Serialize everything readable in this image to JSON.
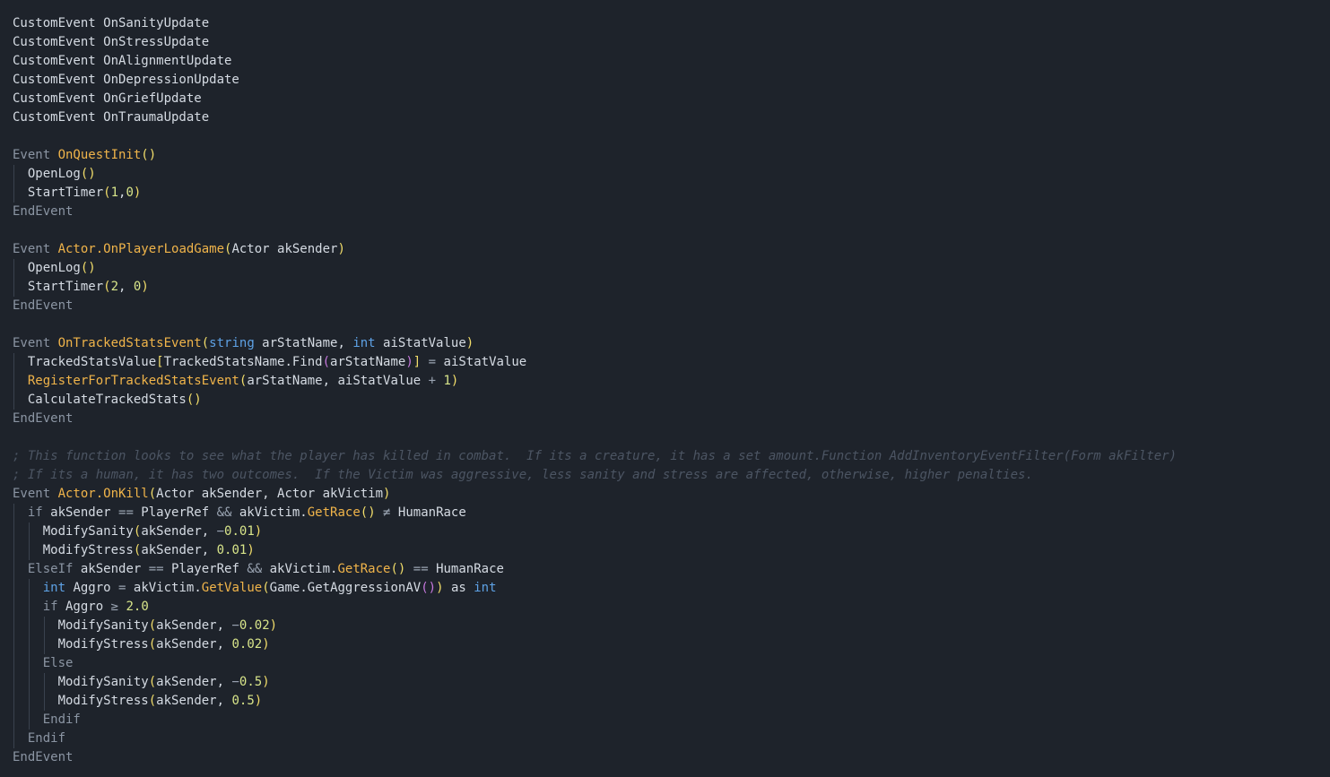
{
  "theme": {
    "background": "#1e232b",
    "text": "#d5dbe3",
    "keyword": "#8b95a3",
    "type": "#5ea2e6",
    "function": "#f0b44a",
    "bracket": "#f2dd6a",
    "bracket_nested": "#c678dd",
    "number": "#d8e58a",
    "operator": "#9aa4b2",
    "comment": "#4c5563"
  },
  "code": {
    "lines": [
      {
        "indent": 0,
        "tokens": [
          {
            "t": "CustomEvent OnSanityUpdate",
            "c": "default"
          }
        ]
      },
      {
        "indent": 0,
        "tokens": [
          {
            "t": "CustomEvent OnStressUpdate",
            "c": "default"
          }
        ]
      },
      {
        "indent": 0,
        "tokens": [
          {
            "t": "CustomEvent OnAlignmentUpdate",
            "c": "default"
          }
        ]
      },
      {
        "indent": 0,
        "tokens": [
          {
            "t": "CustomEvent OnDepressionUpdate",
            "c": "default"
          }
        ]
      },
      {
        "indent": 0,
        "tokens": [
          {
            "t": "CustomEvent OnGriefUpdate",
            "c": "default"
          }
        ]
      },
      {
        "indent": 0,
        "tokens": [
          {
            "t": "CustomEvent OnTraumaUpdate",
            "c": "default"
          }
        ]
      },
      {
        "indent": 0,
        "tokens": []
      },
      {
        "indent": 0,
        "tokens": [
          {
            "t": "Event ",
            "c": "kw"
          },
          {
            "t": "OnQuestInit",
            "c": "fn"
          },
          {
            "t": "()",
            "c": "punc"
          }
        ]
      },
      {
        "indent": 1,
        "tokens": [
          {
            "t": "OpenLog",
            "c": "default"
          },
          {
            "t": "()",
            "c": "punc"
          }
        ]
      },
      {
        "indent": 1,
        "tokens": [
          {
            "t": "StartTimer",
            "c": "default"
          },
          {
            "t": "(",
            "c": "punc"
          },
          {
            "t": "1",
            "c": "num"
          },
          {
            "t": ",",
            "c": "default"
          },
          {
            "t": "0",
            "c": "num"
          },
          {
            "t": ")",
            "c": "punc"
          }
        ]
      },
      {
        "indent": 0,
        "tokens": [
          {
            "t": "EndEvent",
            "c": "kw"
          }
        ]
      },
      {
        "indent": 0,
        "tokens": []
      },
      {
        "indent": 0,
        "tokens": [
          {
            "t": "Event ",
            "c": "kw"
          },
          {
            "t": "Actor.OnPlayerLoadGame",
            "c": "fn"
          },
          {
            "t": "(",
            "c": "punc"
          },
          {
            "t": "Actor akSender",
            "c": "default"
          },
          {
            "t": ")",
            "c": "punc"
          }
        ]
      },
      {
        "indent": 1,
        "tokens": [
          {
            "t": "OpenLog",
            "c": "default"
          },
          {
            "t": "()",
            "c": "punc"
          }
        ]
      },
      {
        "indent": 1,
        "tokens": [
          {
            "t": "StartTimer",
            "c": "default"
          },
          {
            "t": "(",
            "c": "punc"
          },
          {
            "t": "2",
            "c": "num"
          },
          {
            "t": ", ",
            "c": "default"
          },
          {
            "t": "0",
            "c": "num"
          },
          {
            "t": ")",
            "c": "punc"
          }
        ]
      },
      {
        "indent": 0,
        "tokens": [
          {
            "t": "EndEvent",
            "c": "kw"
          }
        ]
      },
      {
        "indent": 0,
        "tokens": []
      },
      {
        "indent": 0,
        "tokens": [
          {
            "t": "Event ",
            "c": "kw"
          },
          {
            "t": "OnTrackedStatsEvent",
            "c": "fn"
          },
          {
            "t": "(",
            "c": "punc"
          },
          {
            "t": "string",
            "c": "type"
          },
          {
            "t": " arStatName, ",
            "c": "default"
          },
          {
            "t": "int",
            "c": "type"
          },
          {
            "t": " aiStatValue",
            "c": "default"
          },
          {
            "t": ")",
            "c": "punc"
          }
        ]
      },
      {
        "indent": 1,
        "tokens": [
          {
            "t": "TrackedStatsValue",
            "c": "default"
          },
          {
            "t": "[",
            "c": "punc"
          },
          {
            "t": "TrackedStatsName.Find",
            "c": "default"
          },
          {
            "t": "(",
            "c": "bracket2"
          },
          {
            "t": "arStatName",
            "c": "default"
          },
          {
            "t": ")",
            "c": "bracket2"
          },
          {
            "t": "]",
            "c": "punc"
          },
          {
            "t": " = ",
            "c": "op"
          },
          {
            "t": "aiStatValue",
            "c": "default"
          }
        ]
      },
      {
        "indent": 1,
        "tokens": [
          {
            "t": "RegisterForTrackedStatsEvent",
            "c": "fn"
          },
          {
            "t": "(",
            "c": "punc"
          },
          {
            "t": "arStatName, aiStatValue ",
            "c": "default"
          },
          {
            "t": "+",
            "c": "op"
          },
          {
            "t": " 1",
            "c": "num"
          },
          {
            "t": ")",
            "c": "punc"
          }
        ]
      },
      {
        "indent": 1,
        "tokens": [
          {
            "t": "CalculateTrackedStats",
            "c": "default"
          },
          {
            "t": "()",
            "c": "punc"
          }
        ]
      },
      {
        "indent": 0,
        "tokens": [
          {
            "t": "EndEvent",
            "c": "kw"
          }
        ]
      },
      {
        "indent": 0,
        "tokens": []
      },
      {
        "indent": 0,
        "tokens": [
          {
            "t": "; This function looks to see what the player has killed in combat.  If its a creature, it has a set amount.Function AddInventoryEventFilter(Form akFilter)",
            "c": "comment"
          }
        ]
      },
      {
        "indent": 0,
        "tokens": [
          {
            "t": "; If its a human, it has two outcomes.  If the Victim was aggressive, less sanity and stress are affected, otherwise, higher penalties.",
            "c": "comment"
          }
        ]
      },
      {
        "indent": 0,
        "tokens": [
          {
            "t": "Event ",
            "c": "kw"
          },
          {
            "t": "Actor.OnKill",
            "c": "fn"
          },
          {
            "t": "(",
            "c": "punc"
          },
          {
            "t": "Actor akSender, Actor akVictim",
            "c": "default"
          },
          {
            "t": ")",
            "c": "punc"
          }
        ]
      },
      {
        "indent": 1,
        "tokens": [
          {
            "t": "if",
            "c": "kw"
          },
          {
            "t": " akSender ",
            "c": "default"
          },
          {
            "t": "==",
            "c": "op"
          },
          {
            "t": " PlayerRef ",
            "c": "default"
          },
          {
            "t": "&&",
            "c": "op"
          },
          {
            "t": " akVictim.",
            "c": "default"
          },
          {
            "t": "GetRace",
            "c": "fn"
          },
          {
            "t": "()",
            "c": "punc"
          },
          {
            "t": " ≠ ",
            "c": "op"
          },
          {
            "t": "HumanRace",
            "c": "default"
          }
        ]
      },
      {
        "indent": 2,
        "tokens": [
          {
            "t": "ModifySanity",
            "c": "default"
          },
          {
            "t": "(",
            "c": "punc"
          },
          {
            "t": "akSender, ",
            "c": "default"
          },
          {
            "t": "−",
            "c": "op"
          },
          {
            "t": "0.01",
            "c": "num"
          },
          {
            "t": ")",
            "c": "punc"
          }
        ]
      },
      {
        "indent": 2,
        "tokens": [
          {
            "t": "ModifyStress",
            "c": "default"
          },
          {
            "t": "(",
            "c": "punc"
          },
          {
            "t": "akSender, ",
            "c": "default"
          },
          {
            "t": "0.01",
            "c": "num"
          },
          {
            "t": ")",
            "c": "punc"
          }
        ]
      },
      {
        "indent": 1,
        "tokens": [
          {
            "t": "ElseIf",
            "c": "kw"
          },
          {
            "t": " akSender ",
            "c": "default"
          },
          {
            "t": "==",
            "c": "op"
          },
          {
            "t": " PlayerRef ",
            "c": "default"
          },
          {
            "t": "&&",
            "c": "op"
          },
          {
            "t": " akVictim.",
            "c": "default"
          },
          {
            "t": "GetRace",
            "c": "fn"
          },
          {
            "t": "()",
            "c": "punc"
          },
          {
            "t": " == ",
            "c": "op"
          },
          {
            "t": "HumanRace",
            "c": "default"
          }
        ]
      },
      {
        "indent": 2,
        "tokens": [
          {
            "t": "int",
            "c": "type"
          },
          {
            "t": " Aggro ",
            "c": "default"
          },
          {
            "t": "=",
            "c": "op"
          },
          {
            "t": " akVictim.",
            "c": "default"
          },
          {
            "t": "GetValue",
            "c": "fn"
          },
          {
            "t": "(",
            "c": "punc"
          },
          {
            "t": "Game.GetAggressionAV",
            "c": "default"
          },
          {
            "t": "()",
            "c": "bracket2"
          },
          {
            "t": ")",
            "c": "punc"
          },
          {
            "t": " as ",
            "c": "default"
          },
          {
            "t": "int",
            "c": "type"
          }
        ]
      },
      {
        "indent": 2,
        "tokens": [
          {
            "t": "if",
            "c": "kw"
          },
          {
            "t": " Aggro ",
            "c": "default"
          },
          {
            "t": "≥",
            "c": "op"
          },
          {
            "t": " 2.0",
            "c": "num"
          }
        ]
      },
      {
        "indent": 3,
        "tokens": [
          {
            "t": "ModifySanity",
            "c": "default"
          },
          {
            "t": "(",
            "c": "punc"
          },
          {
            "t": "akSender, ",
            "c": "default"
          },
          {
            "t": "−",
            "c": "op"
          },
          {
            "t": "0.02",
            "c": "num"
          },
          {
            "t": ")",
            "c": "punc"
          }
        ]
      },
      {
        "indent": 3,
        "tokens": [
          {
            "t": "ModifyStress",
            "c": "default"
          },
          {
            "t": "(",
            "c": "punc"
          },
          {
            "t": "akSender, ",
            "c": "default"
          },
          {
            "t": "0.02",
            "c": "num"
          },
          {
            "t": ")",
            "c": "punc"
          }
        ]
      },
      {
        "indent": 2,
        "tokens": [
          {
            "t": "Else",
            "c": "kw"
          }
        ]
      },
      {
        "indent": 3,
        "tokens": [
          {
            "t": "ModifySanity",
            "c": "default"
          },
          {
            "t": "(",
            "c": "punc"
          },
          {
            "t": "akSender, ",
            "c": "default"
          },
          {
            "t": "−",
            "c": "op"
          },
          {
            "t": "0.5",
            "c": "num"
          },
          {
            "t": ")",
            "c": "punc"
          }
        ]
      },
      {
        "indent": 3,
        "tokens": [
          {
            "t": "ModifyStress",
            "c": "default"
          },
          {
            "t": "(",
            "c": "punc"
          },
          {
            "t": "akSender, ",
            "c": "default"
          },
          {
            "t": "0.5",
            "c": "num"
          },
          {
            "t": ")",
            "c": "punc"
          }
        ]
      },
      {
        "indent": 2,
        "tokens": [
          {
            "t": "Endif",
            "c": "kw"
          }
        ]
      },
      {
        "indent": 1,
        "tokens": [
          {
            "t": "Endif",
            "c": "kw"
          }
        ]
      },
      {
        "indent": 0,
        "tokens": [
          {
            "t": "EndEvent",
            "c": "kw"
          }
        ]
      }
    ]
  }
}
